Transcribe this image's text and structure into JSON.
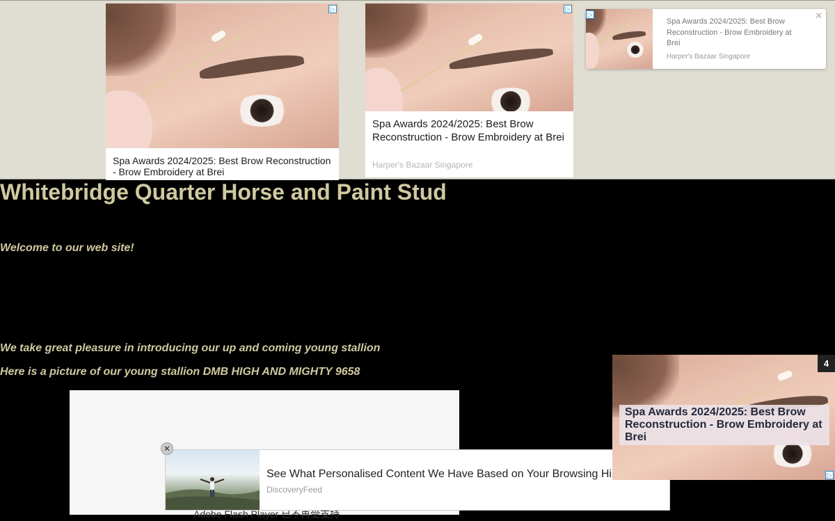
{
  "ads": {
    "ad1": {
      "title": "Spa Awards 2024/2025: Best Brow Reconstruction - Brow Embroidery at Brei"
    },
    "ad2": {
      "title": "Spa Awards 2024/2025: Best Brow Reconstruction - Brow Embroidery at Brei",
      "source": "Harper's Bazaar Singapore"
    },
    "ad3": {
      "title": "Spa Awards 2024/2025: Best Brow Reconstruction - Brow Embroidery at Brei",
      "source": "Harper's Bazaar Singapore",
      "close": "✕"
    },
    "corner": {
      "title": "Spa Awards 2024/2025: Best Brow Reconstruction - Brow Embroidery at Brei",
      "count": "4"
    },
    "bottom": {
      "title": "See What Personalised Content We Have Based on Your Browsing History",
      "source": "DiscoveryFeed",
      "close": "✕"
    },
    "adchoice": "▷"
  },
  "page": {
    "title": "Whitebridge Quarter Horse and Paint Stud",
    "welcome": "Welcome to our web site!",
    "intro": "We take great pleasure in introducing our up and coming young stallion",
    "picture_caption": "Here is a picture of our young stallion DMB HIGH AND MIGHTY 9658",
    "flash_notice": "Adobe Flash Player 已不再受支持"
  },
  "colors": {
    "page_text": "#cfc9a0",
    "banner_bg": "#e0ddd2",
    "page_bg": "#000000",
    "adchoice": "#1d8fd1"
  }
}
